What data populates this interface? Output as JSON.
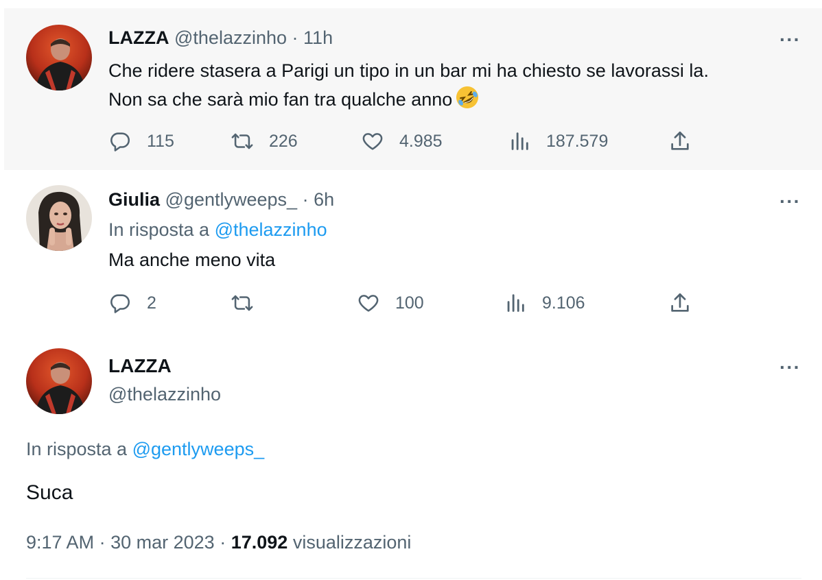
{
  "tweets": [
    {
      "name": "LAZZA",
      "handle": "@thelazzinho",
      "separator": "·",
      "time": "11h",
      "line1": "Che ridere stasera a Parigi un tipo in un bar mi ha chiesto se lavorassi la.",
      "line2": "Non sa che sarà mio fan tra qualche anno",
      "emoji": "rolling-on-floor-laughing-emoji",
      "replies": "115",
      "retweets": "226",
      "likes": "4.985",
      "views": "187.579"
    },
    {
      "name": "Giulia",
      "handle": "@gentlyweeps_",
      "separator": "·",
      "time": "6h",
      "reply_prefix": "In risposta a",
      "reply_mention": "@thelazzinho",
      "text": "Ma anche meno vita",
      "replies": "2",
      "retweets": "",
      "likes": "100",
      "views": "9.106"
    }
  ],
  "main_tweet": {
    "name": "LAZZA",
    "handle": "@thelazzinho",
    "reply_prefix": "In risposta a",
    "reply_mention": "@gentlyweeps_",
    "text": "Suca",
    "time": "9:17 AM",
    "sep1": "·",
    "date": "30 mar 2023",
    "sep2": "·",
    "views_count": "17.092",
    "views_label": "visualizzazioni"
  },
  "more_glyph": "···",
  "colors": {
    "text": "#0f1419",
    "secondary": "#536471",
    "link": "#1d9bf0",
    "highlight_bg": "#f7f7f7",
    "thread_line": "#cfd9de"
  },
  "icons": [
    "reply-icon",
    "retweet-icon",
    "like-icon",
    "views-icon",
    "share-icon",
    "more-icon"
  ]
}
